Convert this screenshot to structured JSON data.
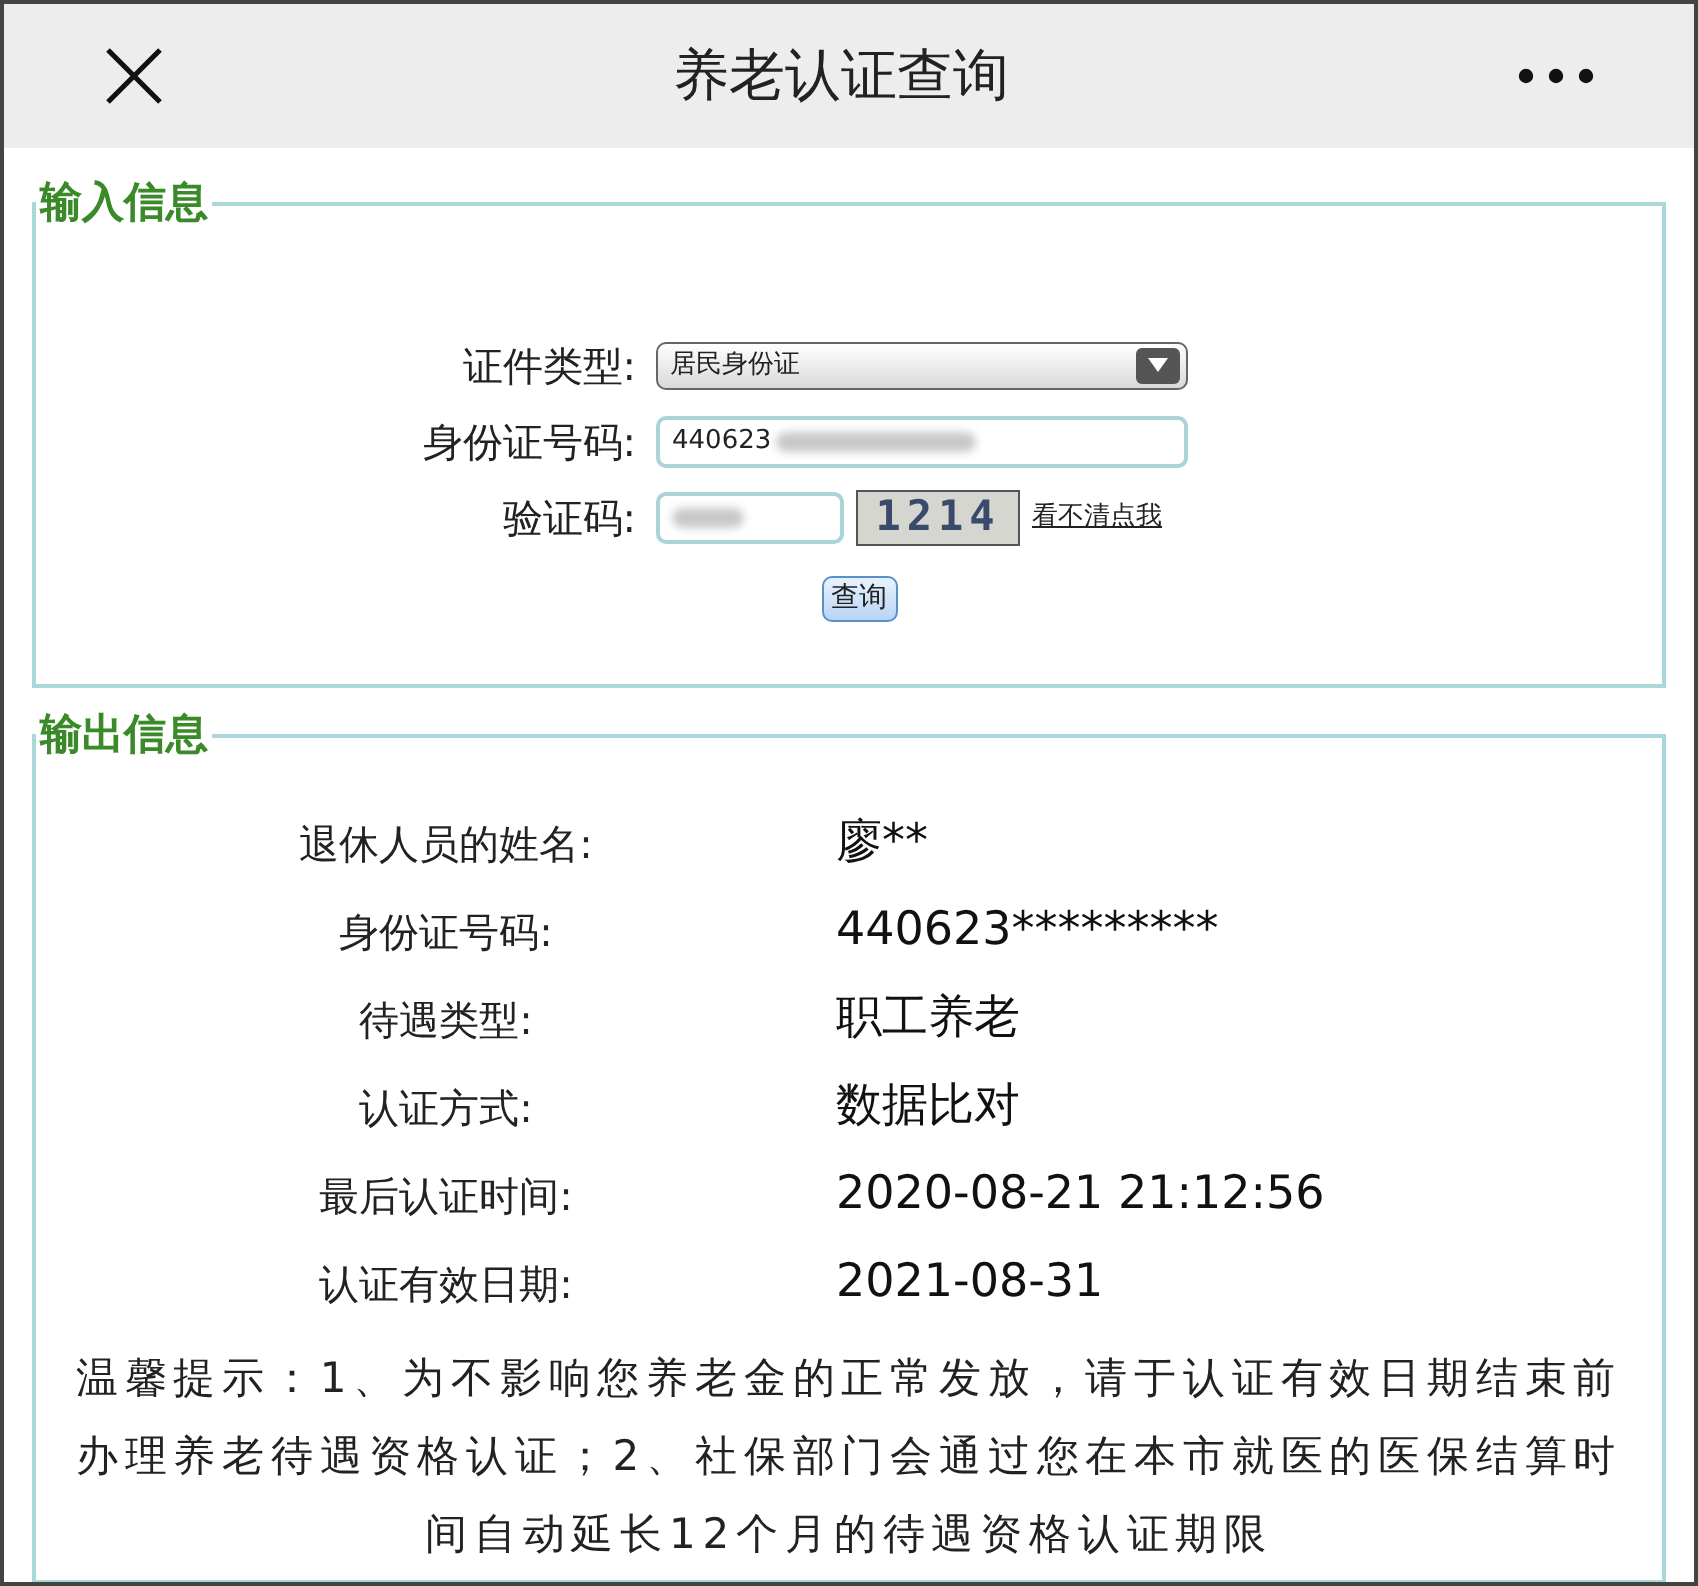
{
  "header": {
    "title": "养老认证查询"
  },
  "input_section": {
    "legend": "输入信息",
    "fields": [
      {
        "kind": "select",
        "label": "证件类型:",
        "value": "居民身份证"
      },
      {
        "kind": "text",
        "label": "身份证号码:",
        "value": "440623",
        "redacted": true
      },
      {
        "kind": "captcha",
        "label": "验证码:",
        "redacted": true,
        "captcha": "1214",
        "refresh_link": "看不清点我"
      }
    ],
    "button": "查询"
  },
  "output_section": {
    "legend": "输出信息",
    "rows": [
      {
        "label": "退休人员的姓名:",
        "value": "廖**"
      },
      {
        "label": "身份证号码:",
        "value": "440623*********"
      },
      {
        "label": "待遇类型:",
        "value": "职工养老"
      },
      {
        "label": "认证方式:",
        "value": "数据比对"
      },
      {
        "label": "最后认证时间:",
        "value": "2020-08-21 21:12:56"
      },
      {
        "label": "认证有效日期:",
        "value": "2021-08-31"
      }
    ],
    "notice": "温馨提示：1、为不影响您养老金的正常发放，请于认证有效日期结束前办理养老待遇资格认证；2、社保部门会通过您在本市就医的医保结算时间自动延长12个月的待遇资格认证期限"
  }
}
